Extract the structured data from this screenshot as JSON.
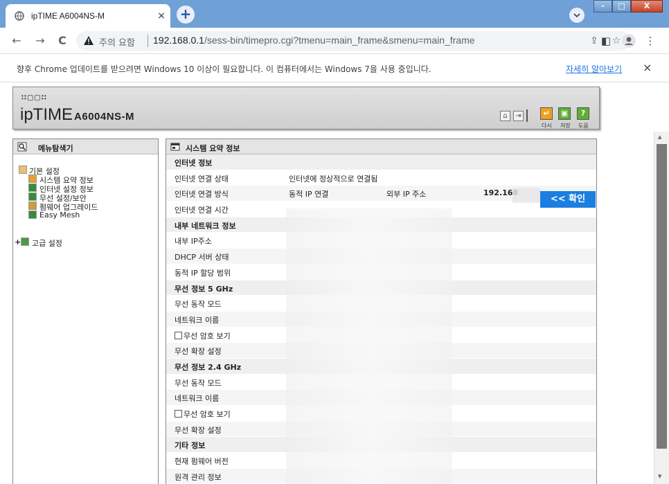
{
  "browser": {
    "tab_title": "ipTIME A6004NS-M",
    "tab_close": "×",
    "new_tab": "+",
    "nav_back": "←",
    "nav_forward": "→",
    "nav_reload": "C",
    "security_label": "주의 요함",
    "url_host": "192.168.0.1",
    "url_path": "/sess-bin/timepro.cgi?tmenu=main_frame&smenu=main_frame"
  },
  "infobar": {
    "message": "향후 Chrome 업데이트를 받으려면 Windows 10 이상이 필요합니다. 이 컴퓨터에서는 Windows 7을 사용 중입니다.",
    "link": "자세히 알아보기",
    "close": "×"
  },
  "header": {
    "brand": "ipTIME",
    "model": "A6004NS-M",
    "btn_refresh": "다시",
    "btn_save": "저장",
    "btn_help": "도움"
  },
  "sidebar": {
    "title": "메뉴탐색기",
    "basic": "기본 설정",
    "items": [
      "시스템 요약 정보",
      "인터넷 설정 정보",
      "무선 설정/보안",
      "펌웨어 업그레이드",
      "Easy Mesh"
    ],
    "advanced": "고급 설정"
  },
  "main": {
    "title": "시스템 요약 정보",
    "internet_section": "인터넷 정보",
    "conn_status_label": "인터넷 연결 상태",
    "conn_status_value": "인터넷에 정상적으로 연결됨",
    "conn_method_label": "인터넷 연결 방식",
    "conn_method_value": "동적 IP 연결",
    "ext_ip_label": "외부 IP 주소",
    "ext_ip_value": "192.168",
    "confirm_button": "<< 확인",
    "conn_time_label": "인터넷 연결 시간",
    "lan_section": "내부 네트워크 정보",
    "lan_ip_label": "내부 IP주소",
    "dhcp_label": "DHCP 서버 상태",
    "dhcp_range_label": "동적 IP 할당 범위",
    "wifi5_section": "무선 정보 5 GHz",
    "wifi5_mode_label": "무선 동작 모드",
    "wifi5_name_label": "네트워크 이름",
    "wifi5_show_pw": "무선 암호 보기",
    "wifi5_ext_label": "무선 확장 설정",
    "wifi24_section": "무선 정보 2.4 GHz",
    "wifi24_mode_label": "무선 동작 모드",
    "wifi24_name_label": "네트워크 이름",
    "wifi24_show_pw": "무선 암호 보기",
    "wifi24_ext_label": "무선 확장 설정",
    "etc_section": "기타 정보",
    "fw_label": "현재 펌웨어 버전",
    "remote_label": "원격 관리 정보"
  }
}
